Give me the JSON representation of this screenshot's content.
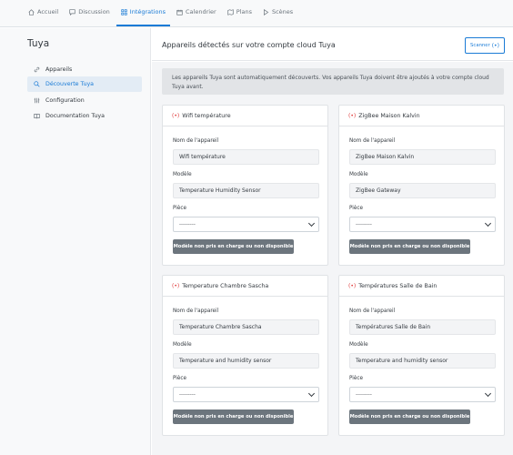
{
  "nav": {
    "tabs": [
      {
        "label": "Accueil",
        "icon": "home-icon"
      },
      {
        "label": "Discussion",
        "icon": "chat-icon"
      },
      {
        "label": "Intégrations",
        "icon": "grid-icon"
      },
      {
        "label": "Calendrier",
        "icon": "calendar-icon"
      },
      {
        "label": "Plans",
        "icon": "map-icon"
      },
      {
        "label": "Scènes",
        "icon": "play-icon"
      }
    ],
    "active_color": "#1a7bd6"
  },
  "sidebar": {
    "title": "Tuya",
    "items": [
      {
        "label": "Appareils",
        "icon": "link-icon"
      },
      {
        "label": "Découverte Tuya",
        "icon": "search-icon"
      },
      {
        "label": "Configuration",
        "icon": "sliders-icon"
      },
      {
        "label": "Documentation Tuya",
        "icon": "book-icon"
      }
    ]
  },
  "main": {
    "title": "Appareils détectés sur votre compte cloud Tuya",
    "scan_label": "Scanner",
    "alert": "Les appareils Tuya sont automatiquement découverts. Vos appareils Tuya doivent être ajoutés à votre compte cloud Tuya avant.",
    "labels": {
      "name": "Nom de l'appareil",
      "model": "Modèle",
      "room": "Pièce",
      "room_placeholder": "---------",
      "unsupported": "Modèle non pris en charge ou non disponible"
    },
    "devices": [
      {
        "title": "Wifi température",
        "name": "Wifi température",
        "model": "Temperature Humidity Sensor"
      },
      {
        "title": "ZigBee Maison Kalvin",
        "name": "ZigBee Maison Kalvin",
        "model": "ZigBee Gateway"
      },
      {
        "title": "Temperature Chambre Sascha",
        "name": "Temperature Chambre Sascha",
        "model": "Temperature and humidity sensor"
      },
      {
        "title": "Températures Salle de Bain",
        "name": "Températures Salle de Bain",
        "model": "Temperature and humidity sensor"
      }
    ]
  }
}
